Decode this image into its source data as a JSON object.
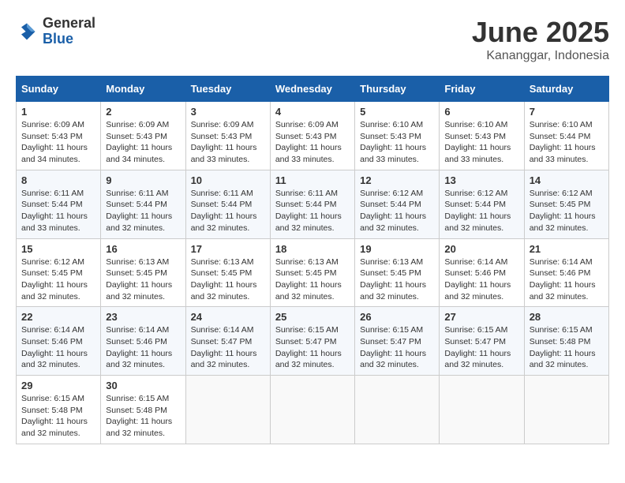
{
  "logo": {
    "general": "General",
    "blue": "Blue"
  },
  "header": {
    "month": "June 2025",
    "location": "Kananggar, Indonesia"
  },
  "weekdays": [
    "Sunday",
    "Monday",
    "Tuesday",
    "Wednesday",
    "Thursday",
    "Friday",
    "Saturday"
  ],
  "weeks": [
    [
      {
        "day": 1,
        "sunrise": "6:09 AM",
        "sunset": "5:43 PM",
        "daylight": "11 hours and 34 minutes."
      },
      {
        "day": 2,
        "sunrise": "6:09 AM",
        "sunset": "5:43 PM",
        "daylight": "11 hours and 34 minutes."
      },
      {
        "day": 3,
        "sunrise": "6:09 AM",
        "sunset": "5:43 PM",
        "daylight": "11 hours and 33 minutes."
      },
      {
        "day": 4,
        "sunrise": "6:09 AM",
        "sunset": "5:43 PM",
        "daylight": "11 hours and 33 minutes."
      },
      {
        "day": 5,
        "sunrise": "6:10 AM",
        "sunset": "5:43 PM",
        "daylight": "11 hours and 33 minutes."
      },
      {
        "day": 6,
        "sunrise": "6:10 AM",
        "sunset": "5:43 PM",
        "daylight": "11 hours and 33 minutes."
      },
      {
        "day": 7,
        "sunrise": "6:10 AM",
        "sunset": "5:44 PM",
        "daylight": "11 hours and 33 minutes."
      }
    ],
    [
      {
        "day": 8,
        "sunrise": "6:11 AM",
        "sunset": "5:44 PM",
        "daylight": "11 hours and 33 minutes."
      },
      {
        "day": 9,
        "sunrise": "6:11 AM",
        "sunset": "5:44 PM",
        "daylight": "11 hours and 32 minutes."
      },
      {
        "day": 10,
        "sunrise": "6:11 AM",
        "sunset": "5:44 PM",
        "daylight": "11 hours and 32 minutes."
      },
      {
        "day": 11,
        "sunrise": "6:11 AM",
        "sunset": "5:44 PM",
        "daylight": "11 hours and 32 minutes."
      },
      {
        "day": 12,
        "sunrise": "6:12 AM",
        "sunset": "5:44 PM",
        "daylight": "11 hours and 32 minutes."
      },
      {
        "day": 13,
        "sunrise": "6:12 AM",
        "sunset": "5:44 PM",
        "daylight": "11 hours and 32 minutes."
      },
      {
        "day": 14,
        "sunrise": "6:12 AM",
        "sunset": "5:45 PM",
        "daylight": "11 hours and 32 minutes."
      }
    ],
    [
      {
        "day": 15,
        "sunrise": "6:12 AM",
        "sunset": "5:45 PM",
        "daylight": "11 hours and 32 minutes."
      },
      {
        "day": 16,
        "sunrise": "6:13 AM",
        "sunset": "5:45 PM",
        "daylight": "11 hours and 32 minutes."
      },
      {
        "day": 17,
        "sunrise": "6:13 AM",
        "sunset": "5:45 PM",
        "daylight": "11 hours and 32 minutes."
      },
      {
        "day": 18,
        "sunrise": "6:13 AM",
        "sunset": "5:45 PM",
        "daylight": "11 hours and 32 minutes."
      },
      {
        "day": 19,
        "sunrise": "6:13 AM",
        "sunset": "5:45 PM",
        "daylight": "11 hours and 32 minutes."
      },
      {
        "day": 20,
        "sunrise": "6:14 AM",
        "sunset": "5:46 PM",
        "daylight": "11 hours and 32 minutes."
      },
      {
        "day": 21,
        "sunrise": "6:14 AM",
        "sunset": "5:46 PM",
        "daylight": "11 hours and 32 minutes."
      }
    ],
    [
      {
        "day": 22,
        "sunrise": "6:14 AM",
        "sunset": "5:46 PM",
        "daylight": "11 hours and 32 minutes."
      },
      {
        "day": 23,
        "sunrise": "6:14 AM",
        "sunset": "5:46 PM",
        "daylight": "11 hours and 32 minutes."
      },
      {
        "day": 24,
        "sunrise": "6:14 AM",
        "sunset": "5:47 PM",
        "daylight": "11 hours and 32 minutes."
      },
      {
        "day": 25,
        "sunrise": "6:15 AM",
        "sunset": "5:47 PM",
        "daylight": "11 hours and 32 minutes."
      },
      {
        "day": 26,
        "sunrise": "6:15 AM",
        "sunset": "5:47 PM",
        "daylight": "11 hours and 32 minutes."
      },
      {
        "day": 27,
        "sunrise": "6:15 AM",
        "sunset": "5:47 PM",
        "daylight": "11 hours and 32 minutes."
      },
      {
        "day": 28,
        "sunrise": "6:15 AM",
        "sunset": "5:48 PM",
        "daylight": "11 hours and 32 minutes."
      }
    ],
    [
      {
        "day": 29,
        "sunrise": "6:15 AM",
        "sunset": "5:48 PM",
        "daylight": "11 hours and 32 minutes."
      },
      {
        "day": 30,
        "sunrise": "6:15 AM",
        "sunset": "5:48 PM",
        "daylight": "11 hours and 32 minutes."
      },
      null,
      null,
      null,
      null,
      null
    ]
  ],
  "labels": {
    "sunrise": "Sunrise:",
    "sunset": "Sunset:",
    "daylight": "Daylight:"
  }
}
